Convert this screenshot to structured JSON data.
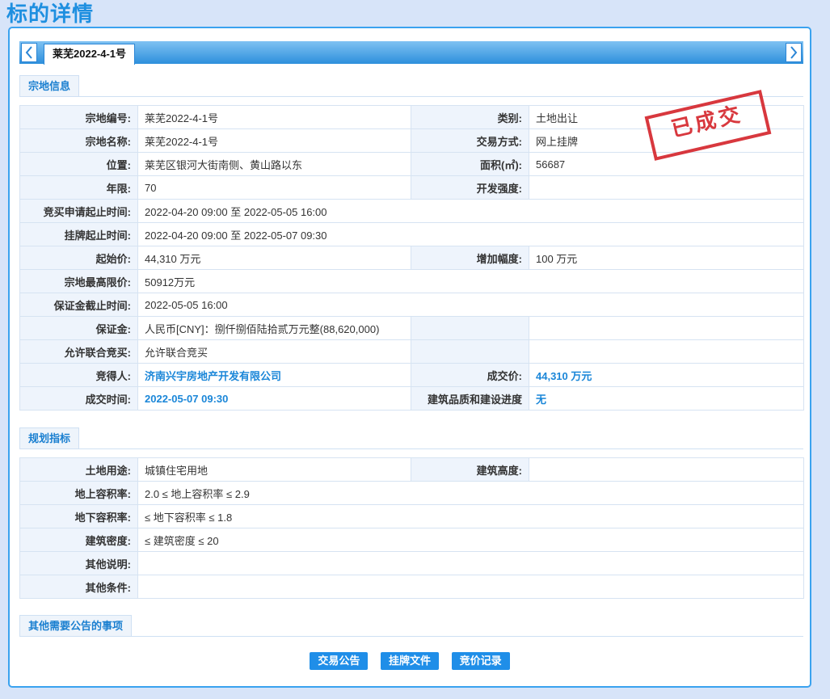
{
  "page_title": "标的详情",
  "tab": {
    "label": "莱芜2022-4-1号"
  },
  "stamp": "已成交",
  "sections": {
    "land_info": "宗地信息",
    "planning": "规划指标",
    "other": "其他需要公告的事项"
  },
  "land": {
    "parcel_no_label": "宗地编号:",
    "parcel_no": "莱芜2022-4-1号",
    "category_label": "类别:",
    "category": "土地出让",
    "parcel_name_label": "宗地名称:",
    "parcel_name": "莱芜2022-4-1号",
    "trade_method_label": "交易方式:",
    "trade_method": "网上挂牌",
    "location_label": "位置:",
    "location": "莱芜区银河大街南侧、黄山路以东",
    "area_label": "面积(㎡):",
    "area": "56687",
    "term_label": "年限:",
    "term": "70",
    "intensity_label": "开发强度:",
    "intensity": "",
    "apply_time_label": "竞买申请起止时间:",
    "apply_time": "2022-04-20 09:00 至 2022-05-05 16:00",
    "listing_time_label": "挂牌起止时间:",
    "listing_time": "2022-04-20 09:00 至 2022-05-07 09:30",
    "start_price_label": "起始价:",
    "start_price": "44,310 万元",
    "increment_label": "增加幅度:",
    "increment": "100 万元",
    "max_price_label": "宗地最高限价:",
    "max_price": "50912万元",
    "deposit_deadline_label": "保证金截止时间:",
    "deposit_deadline": "2022-05-05 16:00",
    "deposit_label": "保证金:",
    "deposit": "人民币[CNY]：捌仟捌佰陆拾贰万元整(88,620,000)",
    "joint_label": "允许联合竞买:",
    "joint": "允许联合竞买",
    "winner_label": "竞得人:",
    "winner": "济南兴宇房地产开发有限公司",
    "deal_price_label": "成交价:",
    "deal_price": "44,310 万元",
    "deal_time_label": "成交时间:",
    "deal_time": "2022-05-07 09:30",
    "quality_label": "建筑品质和建设进度",
    "quality": "无"
  },
  "planning": {
    "land_use_label": "土地用途:",
    "land_use": "城镇住宅用地",
    "height_label": "建筑高度:",
    "height": "",
    "far_above_label": "地上容积率:",
    "far_above": "2.0 ≤ 地上容积率 ≤ 2.9",
    "far_below_label": "地下容积率:",
    "far_below": "≤ 地下容积率 ≤ 1.8",
    "density_label": "建筑密度:",
    "density": "≤ 建筑密度 ≤ 20",
    "other_desc_label": "其他说明:",
    "other_desc": "",
    "other_cond_label": "其他条件:",
    "other_cond": ""
  },
  "buttons": {
    "announcement": "交易公告",
    "listing_doc": "挂牌文件",
    "bid_record": "竞价记录"
  },
  "colors": {
    "accent": "#1e8fe0",
    "stamp": "#d4232a",
    "background": "#d7e4f9"
  }
}
